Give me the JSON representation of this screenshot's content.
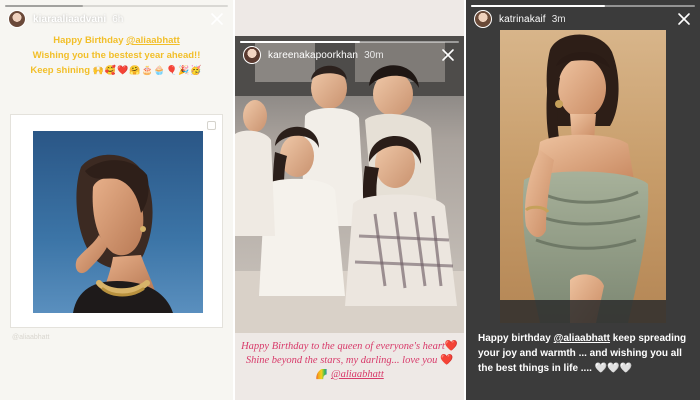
{
  "stories": [
    {
      "username": "kiaraaliaadvani",
      "time": "6h",
      "progress": 0.35,
      "text_line1_prefix": "Happy Birthday ",
      "mention": "@aliaabhatt",
      "text_line2": "Wishing you the bestest year ahead!!",
      "text_line3": "Keep shining",
      "emojis": [
        "🙌",
        "🥰",
        "❤️",
        "🤗",
        "🎂",
        "🧁",
        "🎈",
        "🎉",
        "🥳"
      ],
      "watermark": "@aliaabhatt"
    },
    {
      "username": "kareenakapoorkhan",
      "time": "30m",
      "progress": 0.55,
      "caption_part1": "Happy Birthday to the queen of everyone's heart",
      "heart1": "❤️",
      "caption_part2": " Shine beyond the stars, my darling... love you ",
      "heart2": "❤️",
      "rainbow": "🌈",
      "mention": "@aliaabhatt"
    },
    {
      "username": "katrinakaif",
      "time": "3m",
      "progress": 0.6,
      "caption_prefix": "Happy birthday ",
      "mention": "@aliaabhatt",
      "caption_rest": " keep spreading your joy and warmth ... and wishing you all the best things in life .... ",
      "hearts": "🤍🤍🤍"
    }
  ],
  "icons": {
    "close": "close-icon",
    "avatar": "avatar"
  },
  "colors": {
    "story1_text": "#f2bf29",
    "story2_caption": "#d83a6a",
    "story3_caption": "#ffffff"
  }
}
